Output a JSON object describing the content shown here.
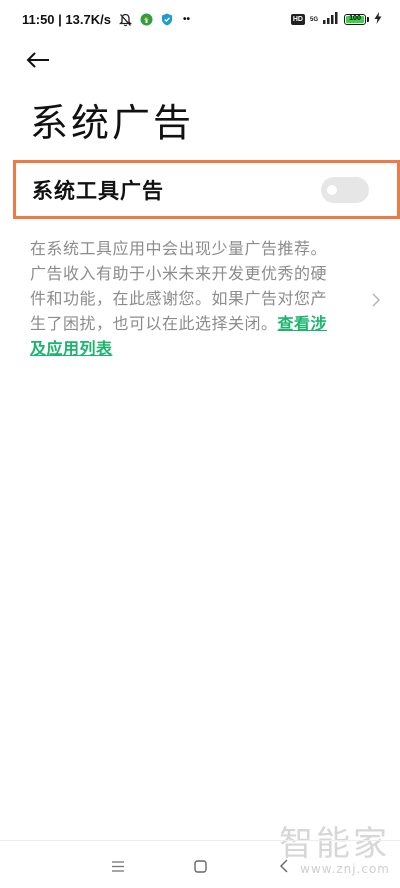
{
  "status_bar": {
    "time_speed": "11:50 | 13.7K/s",
    "network_type": "5G",
    "battery_level": "100",
    "hd_badge": "HD",
    "more": "••"
  },
  "header": {
    "back_icon": "arrow-left-icon",
    "title": "系统广告"
  },
  "setting": {
    "label": "系统工具广告",
    "toggle_on": false,
    "highlight_color": "#ee7a46"
  },
  "description": {
    "text": "在系统工具应用中会出现少量广告推荐。广告收入有助于小米未来开发更优秀的硬件和功能，在此感谢您。如果广告对您产生了困扰，也可以在此选择关闭。",
    "link": "查看涉及应用列表",
    "link_color": "#1cb46e"
  },
  "nav_bar": {
    "menu_icon": "menu-icon",
    "home_icon": "square-icon",
    "back_icon": "chevron-left-icon"
  },
  "watermark": {
    "text": "智能家",
    "url": "www.znj.com"
  }
}
